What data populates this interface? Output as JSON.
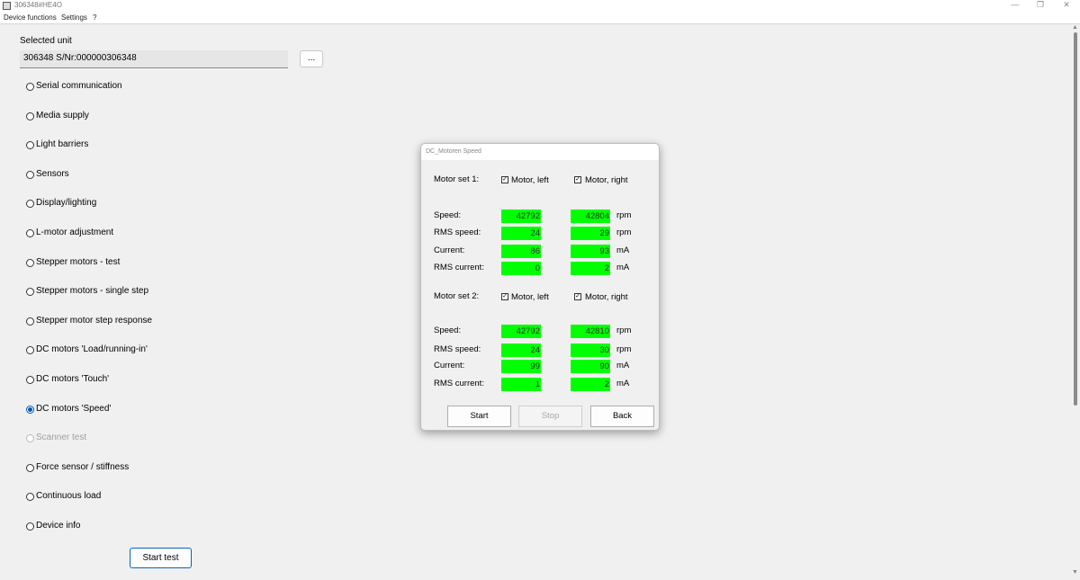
{
  "window": {
    "title": "306348#HE4O",
    "min_glyph": "—",
    "restore_glyph": "❐",
    "close_glyph": "✕"
  },
  "menu": [
    "Device functions",
    "Settings",
    "?"
  ],
  "unit": {
    "heading": "Selected unit",
    "value": "306348 S/Nr:000000306348",
    "browse_label": "..."
  },
  "tests": [
    {
      "label": "Serial communication",
      "checked": false,
      "disabled": false
    },
    {
      "label": "Media supply",
      "checked": false,
      "disabled": false
    },
    {
      "label": "Light barriers",
      "checked": false,
      "disabled": false
    },
    {
      "label": "Sensors",
      "checked": false,
      "disabled": false
    },
    {
      "label": "Display/lighting",
      "checked": false,
      "disabled": false
    },
    {
      "label": "L-motor adjustment",
      "checked": false,
      "disabled": false
    },
    {
      "label": "Stepper motors - test",
      "checked": false,
      "disabled": false
    },
    {
      "label": "Stepper motors - single step",
      "checked": false,
      "disabled": false
    },
    {
      "label": "Stepper motor step response",
      "checked": false,
      "disabled": false
    },
    {
      "label": "DC motors 'Load/running-in'",
      "checked": false,
      "disabled": false
    },
    {
      "label": "DC motors 'Touch'",
      "checked": false,
      "disabled": false
    },
    {
      "label": "DC motors 'Speed'",
      "checked": true,
      "disabled": false
    },
    {
      "label": "Scanner test",
      "checked": false,
      "disabled": true
    },
    {
      "label": "Force sensor / stiffness",
      "checked": false,
      "disabled": false
    },
    {
      "label": "Continuous load",
      "checked": false,
      "disabled": false
    },
    {
      "label": "Device info",
      "checked": false,
      "disabled": false
    }
  ],
  "start_test_label": "Start test",
  "dialog": {
    "title": "DC_Motoren Speed",
    "set1": {
      "label": "Motor set 1:",
      "left_label": "Motor, left",
      "right_label": "Motor, right",
      "left_checked": true,
      "right_checked": true,
      "rows": [
        {
          "label": "Speed:",
          "left": "42792",
          "right": "42804",
          "unit": "rpm"
        },
        {
          "label": "RMS speed:",
          "left": "24",
          "right": "29",
          "unit": "rpm"
        },
        {
          "label": "Current:",
          "left": "86",
          "right": "93",
          "unit": "mA"
        },
        {
          "label": "RMS current:",
          "left": "0",
          "right": "2",
          "unit": "mA"
        }
      ]
    },
    "set2": {
      "label": "Motor set 2:",
      "left_label": "Motor, left",
      "right_label": "Motor, right",
      "left_checked": true,
      "right_checked": true,
      "rows": [
        {
          "label": "Speed:",
          "left": "42792",
          "right": "42810",
          "unit": "rpm"
        },
        {
          "label": "RMS speed:",
          "left": "24",
          "right": "30",
          "unit": "rpm"
        },
        {
          "label": "Current:",
          "left": "99",
          "right": "90",
          "unit": "mA"
        },
        {
          "label": "RMS current:",
          "left": "1",
          "right": "2",
          "unit": "mA"
        }
      ]
    },
    "buttons": {
      "start": "Start",
      "stop": "Stop",
      "back": "Back"
    },
    "value_bg": "#00ff00",
    "check_glyph": "✓"
  },
  "colors": {
    "accent": "#0067c0",
    "radio_selected": "#0058b0"
  }
}
